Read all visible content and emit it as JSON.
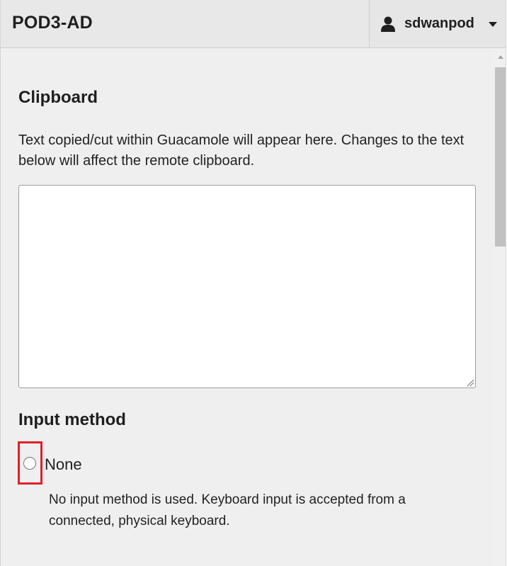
{
  "header": {
    "title": "POD3-AD",
    "user": {
      "icon": "user-icon",
      "name": "sdwanpod",
      "menu_icon": "caret-down-icon"
    }
  },
  "clipboard": {
    "title": "Clipboard",
    "description": "Text copied/cut within Guacamole will appear here. Changes to the text below will affect the remote clipboard.",
    "value": ""
  },
  "input_method": {
    "title": "Input method",
    "options": [
      {
        "label": "None",
        "selected": false,
        "description": "No input method is used. Keyboard input is accepted from a connected, physical keyboard."
      }
    ]
  },
  "colors": {
    "panel_background": "#efefef",
    "header_background": "#e8e8e8",
    "highlight": "#e0202a",
    "scrollbar_thumb": "#c1c1c1"
  }
}
